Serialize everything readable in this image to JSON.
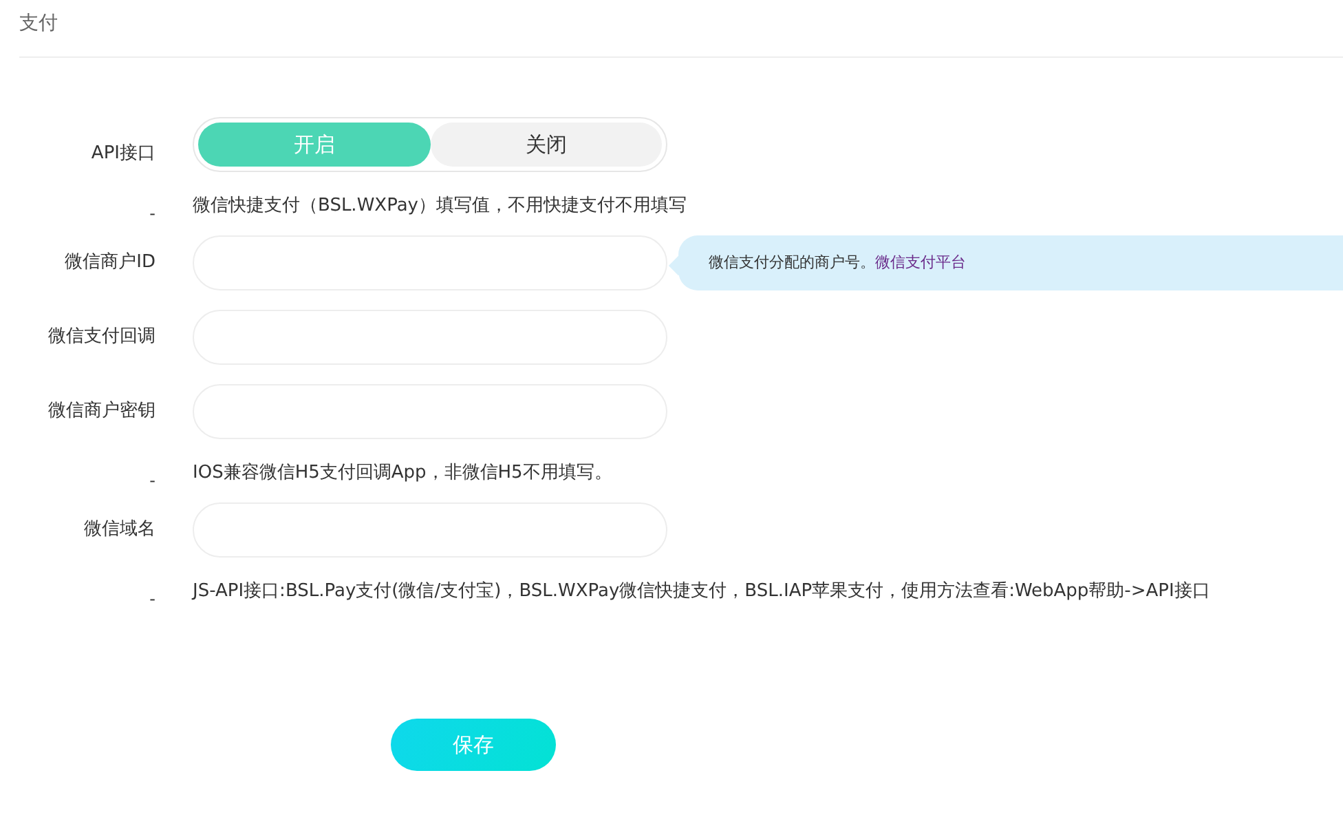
{
  "page_title": "支付",
  "rows": [
    {
      "kind": "toggle",
      "label": "API接口",
      "options": [
        {
          "label": "开启",
          "selected": true
        },
        {
          "label": "关闭",
          "selected": false
        }
      ]
    },
    {
      "kind": "note",
      "label": "-",
      "text": "微信快捷支付（BSL.WXPay）填写值，不用快捷支付不用填写"
    },
    {
      "kind": "field",
      "label": "微信商户ID",
      "tip": {
        "text": "微信支付分配的商户号。",
        "link": "微信支付平台"
      }
    },
    {
      "kind": "field",
      "label": "微信支付回调"
    },
    {
      "kind": "field",
      "label": "微信商户密钥"
    },
    {
      "kind": "note",
      "label": "-",
      "text": "IOS兼容微信H5支付回调App，非微信H5不用填写。"
    },
    {
      "kind": "field",
      "label": "微信域名"
    },
    {
      "kind": "note",
      "label": "-",
      "text": "JS-API接口:BSL.Pay支付(微信/支付宝)，BSL.WXPay微信快捷支付，BSL.IAP苹果支付，使用方法查看:WebApp帮助->API接口"
    }
  ],
  "save_button": "保存"
}
